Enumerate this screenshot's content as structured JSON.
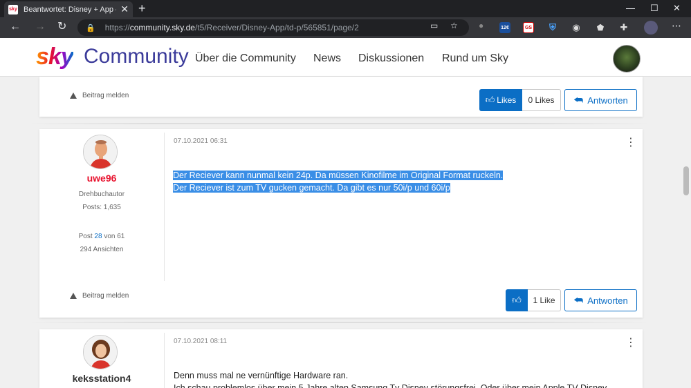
{
  "browser": {
    "tab_title": "Beantwortet: Disney + App – Sei",
    "tab_favicon": "sky",
    "url_prefix": "https://",
    "url_domain": "community.sky.de",
    "url_path": "/t5/Receiver/Disney-App/td-p/565851/page/2",
    "extensions": [
      "12€",
      "GS"
    ]
  },
  "header": {
    "logo_sky": "sky",
    "logo_community": "Community",
    "nav": [
      "Über die Community",
      "News",
      "Diskussionen",
      "Rund um Sky"
    ]
  },
  "post_prev": {
    "report_label": "Beitrag melden",
    "likes_label": "Likes",
    "likes_count": "0 Likes",
    "reply_label": "Antworten"
  },
  "post_1": {
    "username": "uwe96",
    "rank": "Drehbuchautor",
    "posts": "Posts: 1,635",
    "post_pos_prefix": "Post",
    "post_pos_number": "28",
    "post_pos_suffix": "von 61",
    "views": "294 Ansichten",
    "date": "07.10.2021 06:31",
    "line1": "Der Reciever kann nunmal kein 24p. Da müssen Kinofilme im Original Format ruckeln.",
    "line2": "Der Reciever ist zum TV gucken gemacht. Da gibt es nur 50i/p und 60i/p",
    "report_label": "Beitrag melden",
    "likes_count": "1 Like",
    "reply_label": "Antworten"
  },
  "post_2": {
    "username": "keksstation4",
    "date": "07.10.2021 08:11",
    "line1": "Denn muss mal ne vernünftige Hardware ran.",
    "line2": "Ich schau problemlos über mein 5 Jahre alten Samsung Tv Disney störungsfrei. Oder über mein Apple TV Disney"
  }
}
